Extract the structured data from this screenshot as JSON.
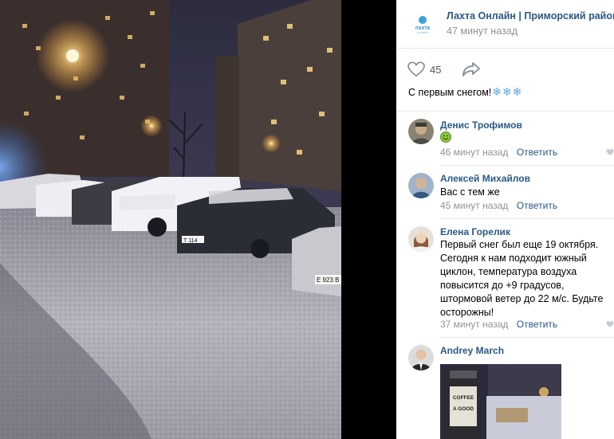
{
  "post": {
    "community_name": "Лахта Онлайн | Приморский район",
    "time": "47 минут назад",
    "likes": "45",
    "text": "С первым снегом!",
    "snowflakes": [
      "❄",
      "❄",
      "❄"
    ],
    "logo_text": "ЛАХТА",
    "logo_sub": "онлайн"
  },
  "comments": [
    {
      "author": "Денис Трофимов",
      "text": "",
      "emoji": "☺",
      "time": "46 минут назад",
      "reply": "Ответить"
    },
    {
      "author": "Алексей Михайлов",
      "text": "Вас с тем же",
      "time": "45 минут назад",
      "reply": "Ответить"
    },
    {
      "author": "Елена Горелик",
      "lines": [
        "Первый снег был еще 19 октября.",
        "Сегодня к нам подходит южный",
        "циклон, температура воздуха",
        "повысится до +9 градусов,",
        "штормовой ветер до 22 м/с. Будьте",
        "осторожны!"
      ],
      "time": "37 минут назад",
      "reply": "Ответить"
    },
    {
      "author": "Andrey March",
      "cup_text": [
        "COFFEE",
        "A GOOD"
      ]
    }
  ],
  "photo": {
    "plates": [
      "Е 923 В",
      "Т 114"
    ]
  }
}
